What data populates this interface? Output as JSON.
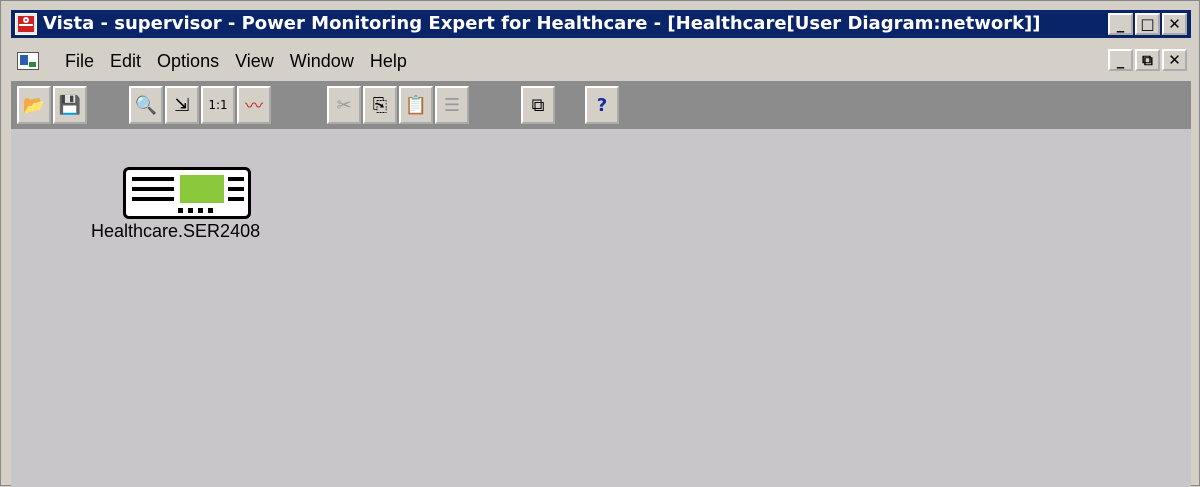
{
  "window": {
    "title": "Vista - supervisor - Power Monitoring Expert for Healthcare - [Healthcare[User Diagram:network]]",
    "app_icon": "vista-app-icon",
    "title_buttons": [
      "_",
      "□",
      "✕"
    ]
  },
  "menubar": {
    "doc_icon": "document-icon",
    "items": [
      "File",
      "Edit",
      "Options",
      "View",
      "Window",
      "Help"
    ],
    "mdi_buttons": [
      "_",
      "⧉",
      "✕"
    ]
  },
  "toolbar": {
    "tools": [
      {
        "name": "open-folder-icon",
        "glyph": "📂"
      },
      {
        "name": "save-icon",
        "glyph": "💾"
      },
      {
        "name": "zoom-icon",
        "glyph": "🔍"
      },
      {
        "name": "fit-window-icon",
        "glyph": "⇲"
      },
      {
        "name": "actual-size-icon",
        "glyph": "1:1"
      },
      {
        "name": "trend-icon",
        "glyph": "〰"
      },
      {
        "name": "cut-icon",
        "glyph": "✂"
      },
      {
        "name": "copy-icon",
        "glyph": "⎘"
      },
      {
        "name": "paste-icon",
        "glyph": "📋"
      },
      {
        "name": "list-icon",
        "glyph": "☰"
      },
      {
        "name": "window-switch-icon",
        "glyph": "⧉"
      },
      {
        "name": "help-icon",
        "glyph": "?"
      }
    ]
  },
  "workspace": {
    "device": {
      "icon": "meter-device-icon",
      "label": "Healthcare.SER2408"
    }
  },
  "colors": {
    "titlebar": "#0a246a",
    "workspace": "#c8c6c8",
    "toolbar": "#8c8c8c",
    "device_screen": "#8cc83c"
  }
}
